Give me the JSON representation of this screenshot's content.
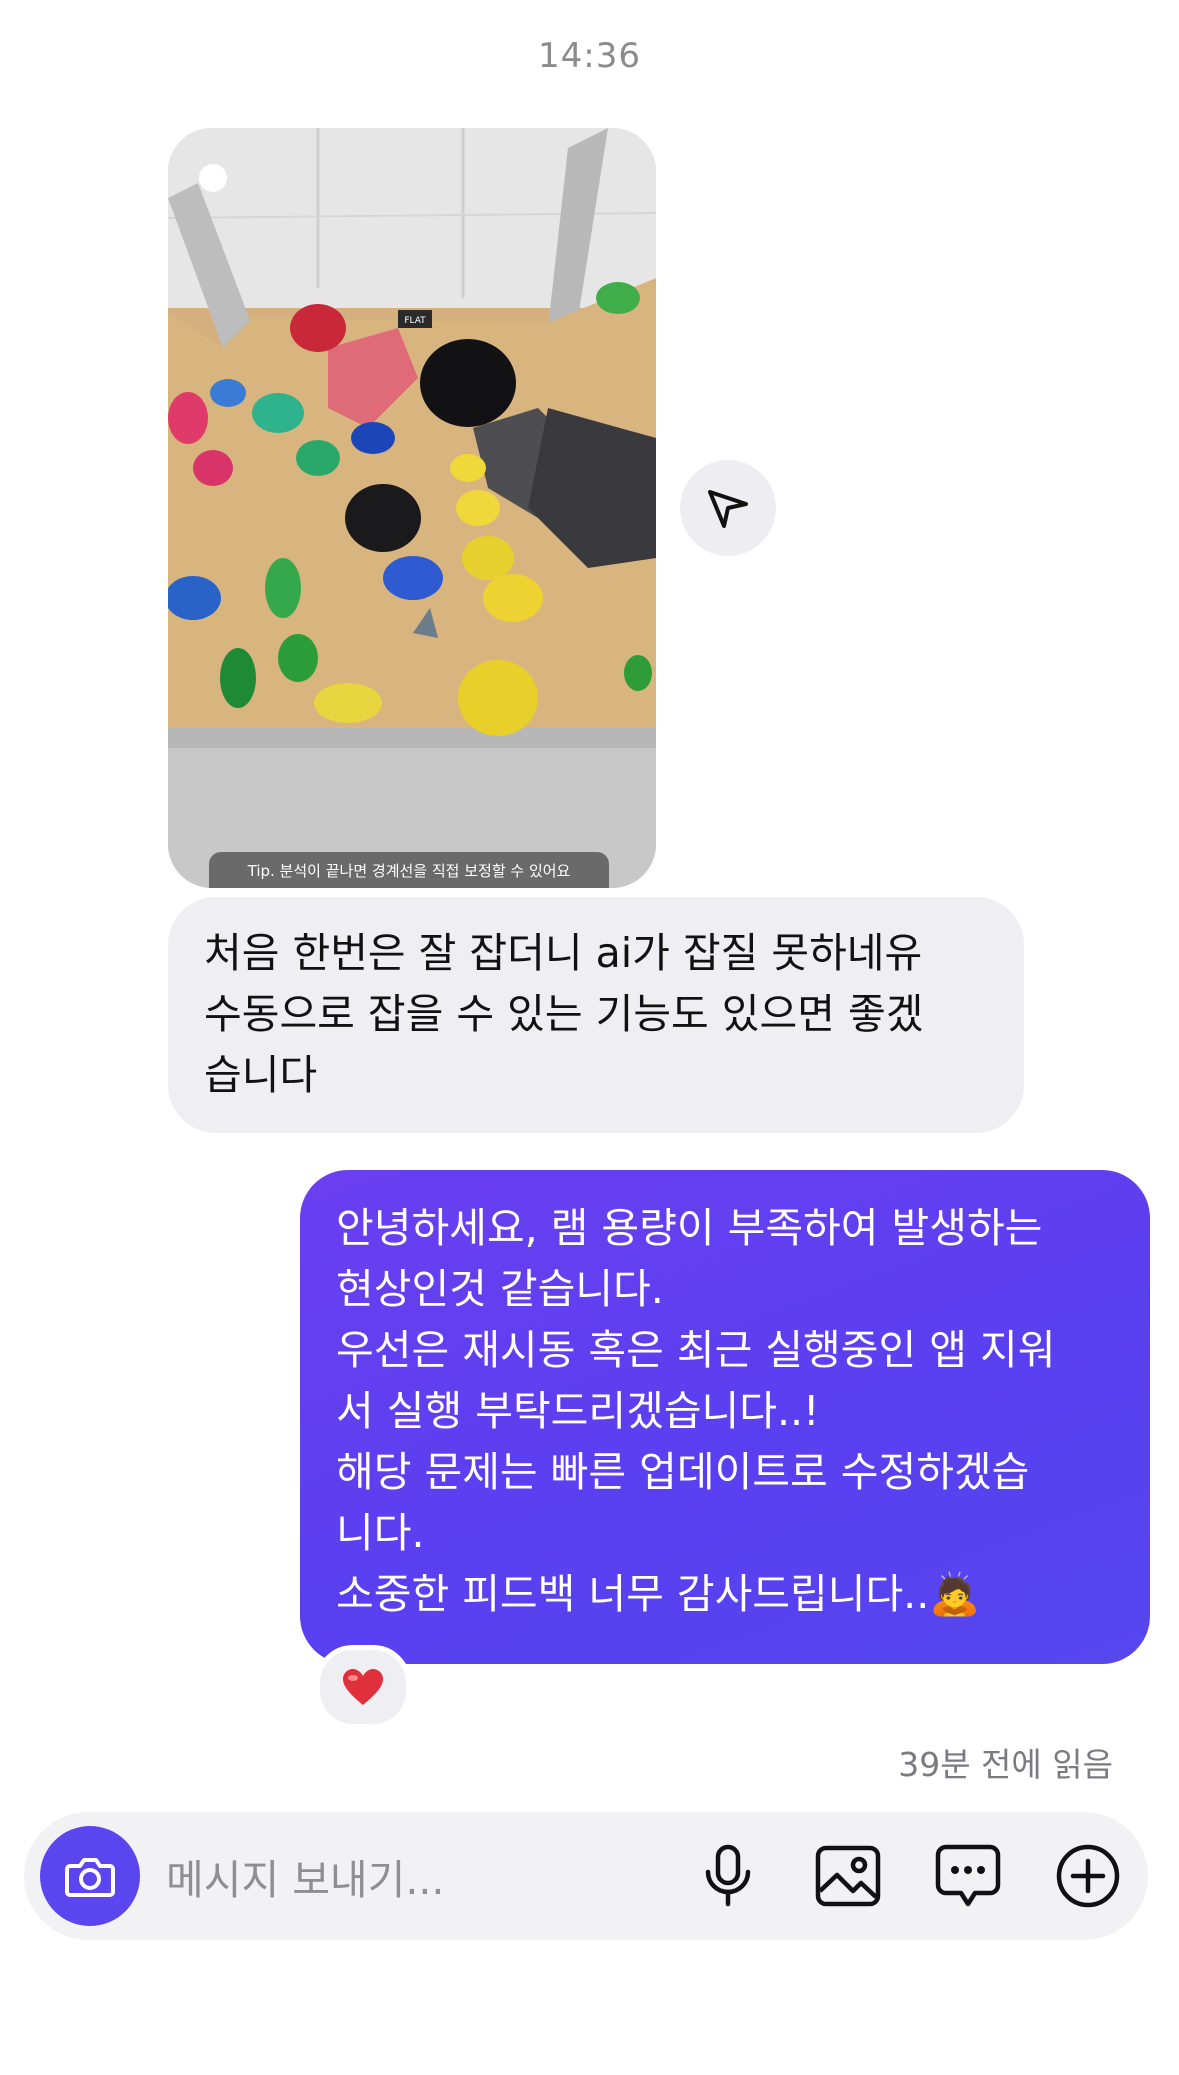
{
  "timestamp": "14:36",
  "photo": {
    "tip_text": "Tip. 분석이 끝나면 경계선을 직접 보정할 수 있어요",
    "wall_sign": "FLAT"
  },
  "share_icon": "send-icon",
  "incoming_message": {
    "lines": [
      "처음 한번은 잘 잡더니 ai가 잡질 못하네유",
      "수동으로 잡을 수 있는 기능도 있으면 좋겠",
      "습니다"
    ]
  },
  "outgoing_message": {
    "lines": [
      "안녕하세요, 램 용량이 부족하여 발생하는",
      "현상인것 같습니다.",
      "우선은 재시동 혹은 최근 실행중인 앱 지워",
      "서 실행 부탁드리겠습니다..!",
      "해당 문제는 빠른 업데이트로 수정하겠습",
      "니다.",
      "소중한 피드백 너무 감사드립니다..🙇"
    ],
    "color": "#5b42f0"
  },
  "reaction": "❤️",
  "read_receipt": "39분 전에 읽음",
  "composer": {
    "placeholder": "메시지 보내기...",
    "icons": [
      "camera-icon",
      "microphone-icon",
      "image-icon",
      "chat-bubble-icon",
      "plus-circle-icon"
    ]
  }
}
